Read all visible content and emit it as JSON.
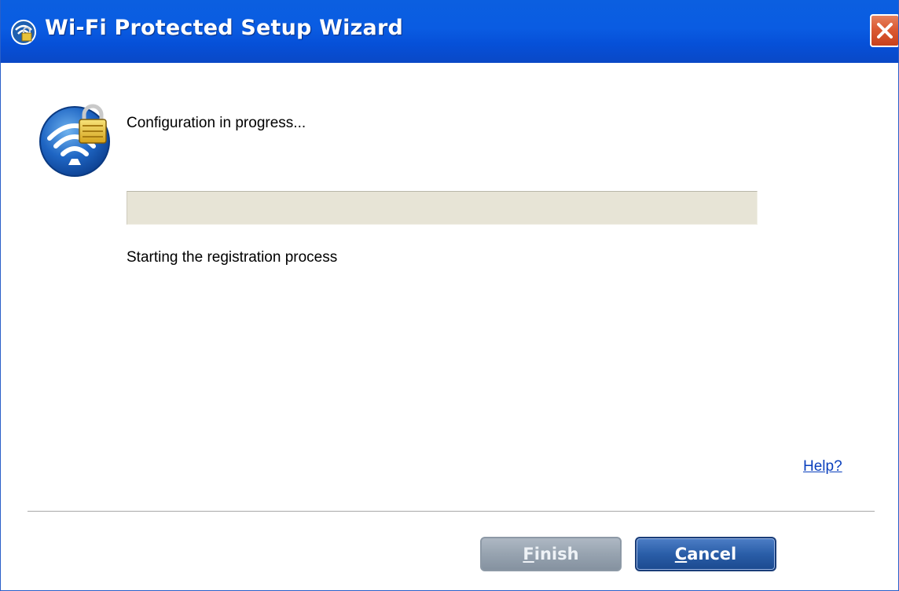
{
  "window": {
    "title": "Wi-Fi Protected Setup Wizard"
  },
  "icons": {
    "title_icon": "wps-lock-icon",
    "wizard_icon": "wireless-lock-icon",
    "close_icon": "close-icon"
  },
  "main": {
    "heading": "Configuration in progress...",
    "progress_fraction": 0,
    "status_text": "Starting the registration process",
    "help_link": "Help?"
  },
  "footer": {
    "finish_label": "Finish",
    "cancel_label": "Cancel"
  },
  "colors": {
    "titlebar": "#0a5ce2",
    "close_button": "#db5a33",
    "link": "#0a3fbd",
    "progress_track": "#e7e4d6",
    "cancel_button": "#2a5ea8",
    "finish_button": "#97a3b0"
  }
}
